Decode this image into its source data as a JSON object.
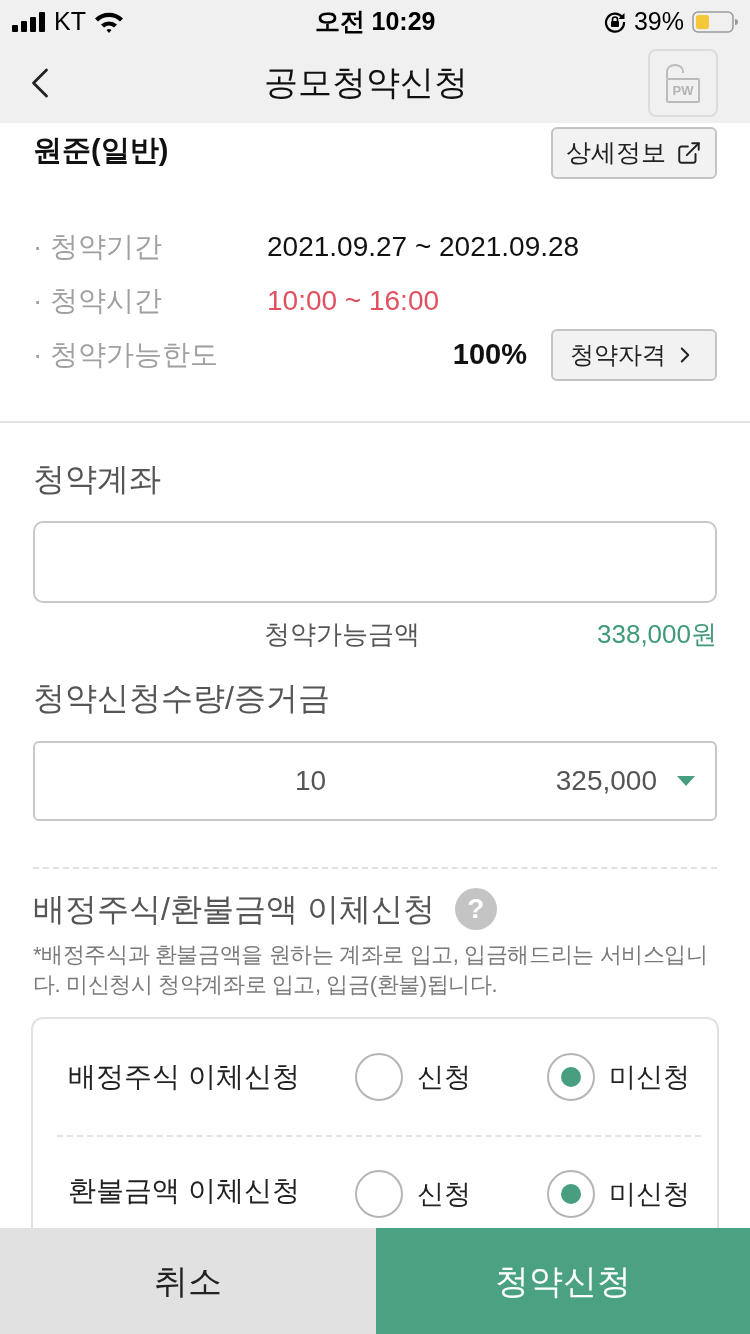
{
  "status_bar": {
    "carrier": "KT",
    "time": "오전 10:29",
    "battery": "39%"
  },
  "nav": {
    "title": "공모청약신청",
    "lock_button": "PW"
  },
  "offering": {
    "name": "원준(일반)",
    "detail_button": "상세정보",
    "rows": [
      {
        "label": "· 청약기간",
        "value": "2021.09.27 ~ 2021.09.28",
        "kind": "text"
      },
      {
        "label": "· 청약시간",
        "value": "10:00 ~ 16:00",
        "kind": "highlight"
      },
      {
        "label": "· 청약가능한도",
        "value": "100%",
        "kind": "limit",
        "button": "청약자격"
      }
    ]
  },
  "account": {
    "label": "청약계좌",
    "available_label": "청약가능금액",
    "available_amount": "338,000원"
  },
  "quantity": {
    "label": "청약신청수량/증거금",
    "quantity": "10",
    "deposit": "325,000"
  },
  "transfer": {
    "title": "배정주식/환불금액 이체신청",
    "help": "?",
    "note": "*배정주식과 환불금액을 원하는 계좌로 입고, 입금해드리는 서비스입니다. 미신청시 청약계좌로 입고, 입금(환불)됩니다.",
    "rows": [
      {
        "label": "배정주식 이체신청",
        "options": [
          {
            "label": "신청",
            "selected": false
          },
          {
            "label": "미신청",
            "selected": true
          }
        ]
      },
      {
        "label": "환불금액 이체신청",
        "options": [
          {
            "label": "신청",
            "selected": false
          },
          {
            "label": "미신청",
            "selected": true
          }
        ]
      }
    ]
  },
  "buttons": [
    {
      "label": "취소",
      "kind": "secondary"
    },
    {
      "label": "청약신청",
      "kind": "primary"
    }
  ]
}
